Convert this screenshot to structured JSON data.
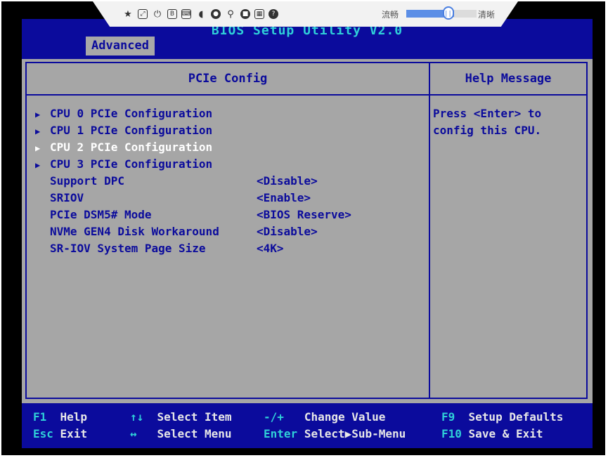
{
  "bios": {
    "title": "BIOS Setup Utility V2.0",
    "active_tab": "Advanced",
    "panel_title": "PCIe Config",
    "help_title": "Help Message",
    "help_text": "Press <Enter> to config this CPU.",
    "items": [
      {
        "label": "CPU 0 PCIe Configuration",
        "submenu": true,
        "value": "",
        "selected": false
      },
      {
        "label": "CPU 1 PCIe Configuration",
        "submenu": true,
        "value": "",
        "selected": false
      },
      {
        "label": "CPU 2 PCIe Configuration",
        "submenu": true,
        "value": "",
        "selected": true
      },
      {
        "label": "CPU 3 PCIe Configuration",
        "submenu": true,
        "value": "",
        "selected": false
      },
      {
        "label": "Support DPC",
        "submenu": false,
        "value": "<Disable>",
        "selected": false
      },
      {
        "label": "SRIOV",
        "submenu": false,
        "value": "<Enable>",
        "selected": false
      },
      {
        "label": "PCIe DSM5# Mode",
        "submenu": false,
        "value": "<BIOS Reserve>",
        "selected": false
      },
      {
        "label": "NVMe GEN4 Disk Workaround",
        "submenu": false,
        "value": "<Disable>",
        "selected": false
      },
      {
        "label": "SR-IOV System Page Size",
        "submenu": false,
        "value": "<4K>",
        "selected": false
      }
    ],
    "footer": {
      "f1_key": "F1",
      "f1_desc": "Help",
      "esc_key": "Esc",
      "esc_desc": "Exit",
      "updown_key": "↑↓",
      "updown_desc": "Select Item",
      "leftright_key": "↔",
      "leftright_desc": "Select Menu",
      "plusminus_key": "-/+",
      "plusminus_desc": "Change Value",
      "enter_key": "Enter",
      "enter_desc": "Select▶Sub-Menu",
      "f9_key": "F9",
      "f9_desc": "Setup Defaults",
      "f10_key": "F10",
      "f10_desc": "Save & Exit"
    }
  },
  "toolbar": {
    "icons": [
      "pin-icon",
      "fullscreen-icon",
      "power-icon",
      "b-icon",
      "keyboard-icon",
      "mouse-icon",
      "media-icon",
      "usb-icon",
      "record-icon",
      "screenshot-icon",
      "help-icon"
    ],
    "fluent_label": "流畅",
    "clear_label": "清晰",
    "quality_level": 0.6
  },
  "colors": {
    "bios_blue": "#0b0b9c",
    "bios_gray": "#a6a6a6",
    "bios_cyan": "#2fd0d8",
    "selected_text": "#ffffff"
  }
}
